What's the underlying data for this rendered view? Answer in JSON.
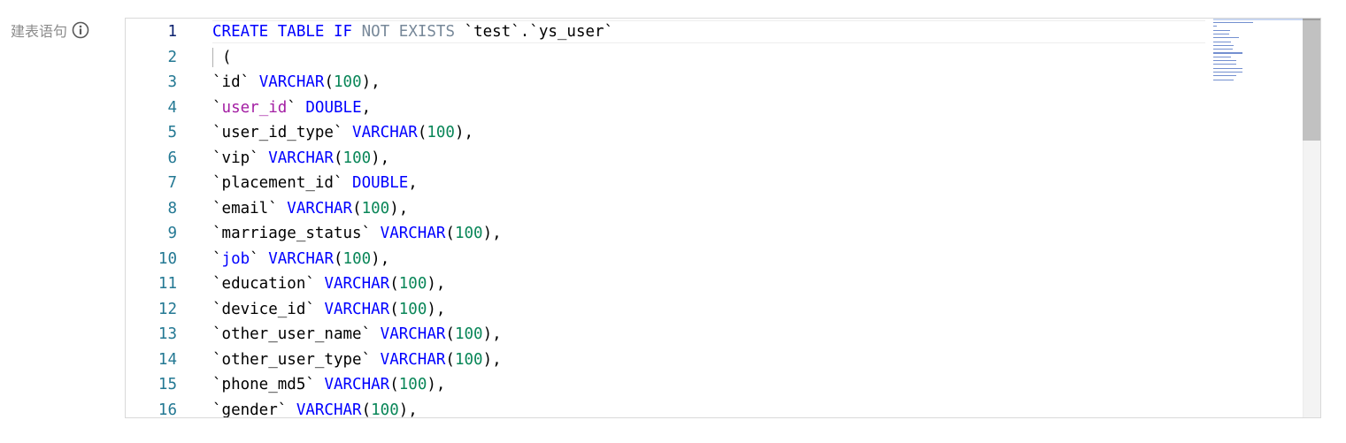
{
  "form": {
    "label": "建表语句"
  },
  "icons": {
    "info": "info-circle-icon"
  },
  "colors": {
    "keyword": "#0000ff",
    "operator": "#778899",
    "number": "#098658",
    "function": "#a31ea3",
    "line_number": "#237893",
    "active_line_number": "#0b216f"
  },
  "editor": {
    "active_line": 1,
    "lines": [
      {
        "number": "1",
        "tokens": [
          {
            "t": "CREATE",
            "c": "kw"
          },
          {
            "t": " ",
            "c": "plain"
          },
          {
            "t": "TABLE",
            "c": "kw"
          },
          {
            "t": " ",
            "c": "plain"
          },
          {
            "t": "IF",
            "c": "kw"
          },
          {
            "t": " ",
            "c": "plain"
          },
          {
            "t": "NOT",
            "c": "op"
          },
          {
            "t": " ",
            "c": "plain"
          },
          {
            "t": "EXISTS",
            "c": "op"
          },
          {
            "t": " `test`.`ys_user`",
            "c": "plain"
          }
        ]
      },
      {
        "number": "2",
        "tokens": [
          {
            "t": "(",
            "c": "plain"
          }
        ],
        "guide": true
      },
      {
        "number": "3",
        "tokens": [
          {
            "t": "`id` ",
            "c": "plain"
          },
          {
            "t": "VARCHAR",
            "c": "type"
          },
          {
            "t": "(",
            "c": "plain"
          },
          {
            "t": "100",
            "c": "num"
          },
          {
            "t": "),",
            "c": "plain"
          }
        ]
      },
      {
        "number": "4",
        "tokens": [
          {
            "t": "`",
            "c": "plain"
          },
          {
            "t": "user_id",
            "c": "fn"
          },
          {
            "t": "` ",
            "c": "plain"
          },
          {
            "t": "DOUBLE",
            "c": "type"
          },
          {
            "t": ",",
            "c": "plain"
          }
        ]
      },
      {
        "number": "5",
        "tokens": [
          {
            "t": "`user_id_type` ",
            "c": "plain"
          },
          {
            "t": "VARCHAR",
            "c": "type"
          },
          {
            "t": "(",
            "c": "plain"
          },
          {
            "t": "100",
            "c": "num"
          },
          {
            "t": "),",
            "c": "plain"
          }
        ]
      },
      {
        "number": "6",
        "tokens": [
          {
            "t": "`vip` ",
            "c": "plain"
          },
          {
            "t": "VARCHAR",
            "c": "type"
          },
          {
            "t": "(",
            "c": "plain"
          },
          {
            "t": "100",
            "c": "num"
          },
          {
            "t": "),",
            "c": "plain"
          }
        ]
      },
      {
        "number": "7",
        "tokens": [
          {
            "t": "`placement_id` ",
            "c": "plain"
          },
          {
            "t": "DOUBLE",
            "c": "type"
          },
          {
            "t": ",",
            "c": "plain"
          }
        ]
      },
      {
        "number": "8",
        "tokens": [
          {
            "t": "`email` ",
            "c": "plain"
          },
          {
            "t": "VARCHAR",
            "c": "type"
          },
          {
            "t": "(",
            "c": "plain"
          },
          {
            "t": "100",
            "c": "num"
          },
          {
            "t": "),",
            "c": "plain"
          }
        ]
      },
      {
        "number": "9",
        "tokens": [
          {
            "t": "`marriage_status` ",
            "c": "plain"
          },
          {
            "t": "VARCHAR",
            "c": "type"
          },
          {
            "t": "(",
            "c": "plain"
          },
          {
            "t": "100",
            "c": "num"
          },
          {
            "t": "),",
            "c": "plain"
          }
        ]
      },
      {
        "number": "10",
        "tokens": [
          {
            "t": "`",
            "c": "plain"
          },
          {
            "t": "job",
            "c": "kw"
          },
          {
            "t": "` ",
            "c": "plain"
          },
          {
            "t": "VARCHAR",
            "c": "type"
          },
          {
            "t": "(",
            "c": "plain"
          },
          {
            "t": "100",
            "c": "num"
          },
          {
            "t": "),",
            "c": "plain"
          }
        ]
      },
      {
        "number": "11",
        "tokens": [
          {
            "t": "`education` ",
            "c": "plain"
          },
          {
            "t": "VARCHAR",
            "c": "type"
          },
          {
            "t": "(",
            "c": "plain"
          },
          {
            "t": "100",
            "c": "num"
          },
          {
            "t": "),",
            "c": "plain"
          }
        ]
      },
      {
        "number": "12",
        "tokens": [
          {
            "t": "`device_id` ",
            "c": "plain"
          },
          {
            "t": "VARCHAR",
            "c": "type"
          },
          {
            "t": "(",
            "c": "plain"
          },
          {
            "t": "100",
            "c": "num"
          },
          {
            "t": "),",
            "c": "plain"
          }
        ]
      },
      {
        "number": "13",
        "tokens": [
          {
            "t": "`other_user_name` ",
            "c": "plain"
          },
          {
            "t": "VARCHAR",
            "c": "type"
          },
          {
            "t": "(",
            "c": "plain"
          },
          {
            "t": "100",
            "c": "num"
          },
          {
            "t": "),",
            "c": "plain"
          }
        ]
      },
      {
        "number": "14",
        "tokens": [
          {
            "t": "`other_user_type` ",
            "c": "plain"
          },
          {
            "t": "VARCHAR",
            "c": "type"
          },
          {
            "t": "(",
            "c": "plain"
          },
          {
            "t": "100",
            "c": "num"
          },
          {
            "t": "),",
            "c": "plain"
          }
        ]
      },
      {
        "number": "15",
        "tokens": [
          {
            "t": "`phone_md5` ",
            "c": "plain"
          },
          {
            "t": "VARCHAR",
            "c": "type"
          },
          {
            "t": "(",
            "c": "plain"
          },
          {
            "t": "100",
            "c": "num"
          },
          {
            "t": "),",
            "c": "plain"
          }
        ]
      },
      {
        "number": "16",
        "tokens": [
          {
            "t": "`gender` ",
            "c": "plain"
          },
          {
            "t": "VARCHAR",
            "c": "type"
          },
          {
            "t": "(",
            "c": "plain"
          },
          {
            "t": "100",
            "c": "num"
          },
          {
            "t": "),",
            "c": "plain"
          }
        ]
      }
    ]
  }
}
